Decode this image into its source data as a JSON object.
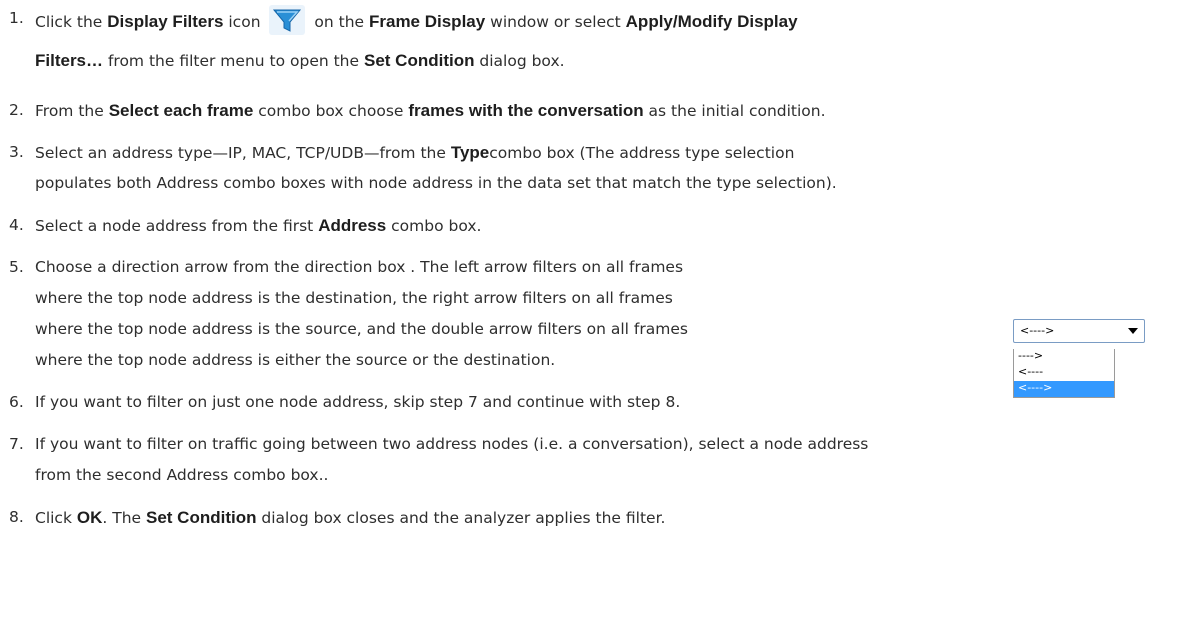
{
  "steps": [
    {
      "num": "1.",
      "line1": [
        {
          "t": "Click the "
        },
        {
          "b": "Display Filters"
        },
        {
          "t": " icon "
        },
        {
          "icon": "filter"
        },
        {
          "t": " on the "
        },
        {
          "b": "Frame Display"
        },
        {
          "t": " window or select "
        },
        {
          "b": "Apply/Modify Display"
        }
      ],
      "line2": [
        {
          "b": "Filters…"
        },
        {
          "t": " from the filter menu to open the "
        },
        {
          "b": "Set Condition"
        },
        {
          "t": " dialog box."
        }
      ]
    },
    {
      "num": "2.",
      "line1": [
        {
          "t": "From the "
        },
        {
          "b": "Select each frame"
        },
        {
          "t": " combo box choose "
        },
        {
          "b": "frames with the conversation"
        },
        {
          "t": " as the initial condition."
        }
      ]
    },
    {
      "num": "3.",
      "line1": [
        {
          "t": "Select an address type—IP, MAC, TCP/UDB—from the "
        },
        {
          "b": "Type"
        },
        {
          "t": "combo box (The address type selection"
        }
      ],
      "line2": [
        {
          "t": "populates both Address combo boxes with node address in the data set that match the type selection)."
        }
      ]
    },
    {
      "num": "4.",
      "line1": [
        {
          "t": "Select a node address from the first "
        },
        {
          "b": "Address"
        },
        {
          "t": " combo box."
        }
      ]
    },
    {
      "num": "5.",
      "lines": [
        "Choose a direction arrow from the direction box . The left arrow filters on all frames",
        "where the top node address is the destination, the right arrow filters on all frames",
        "where  the top node address is the source, and the double arrow filters on all frames",
        "where the top node address is either the source or the destination."
      ]
    },
    {
      "num": "6.",
      "line1": [
        {
          "t": "If you want to filter on just one node address, skip step 7 and continue with step 8."
        }
      ]
    },
    {
      "num": "7.",
      "line1": [
        {
          "t": "If you want to filter on traffic going between two address nodes (i.e. a conversation), select a node address"
        }
      ],
      "line2": [
        {
          "t": "from the second Address combo box.."
        }
      ]
    },
    {
      "num": "8.",
      "line1": [
        {
          "t": "Click "
        },
        {
          "b": "OK"
        },
        {
          "t": ". The "
        },
        {
          "b": "Set Condition"
        },
        {
          "t": " dialog box closes and the analyzer applies the filter."
        }
      ]
    }
  ],
  "direction_box": {
    "selected": "<---->",
    "options": [
      "---->",
      "<----",
      "<---->"
    ],
    "selected_index": 2
  },
  "colors": {
    "text": "#2e2e2e",
    "bold": "#1e1e1e",
    "selection": "#3399ff",
    "filter_icon": "#2a8fd6"
  }
}
